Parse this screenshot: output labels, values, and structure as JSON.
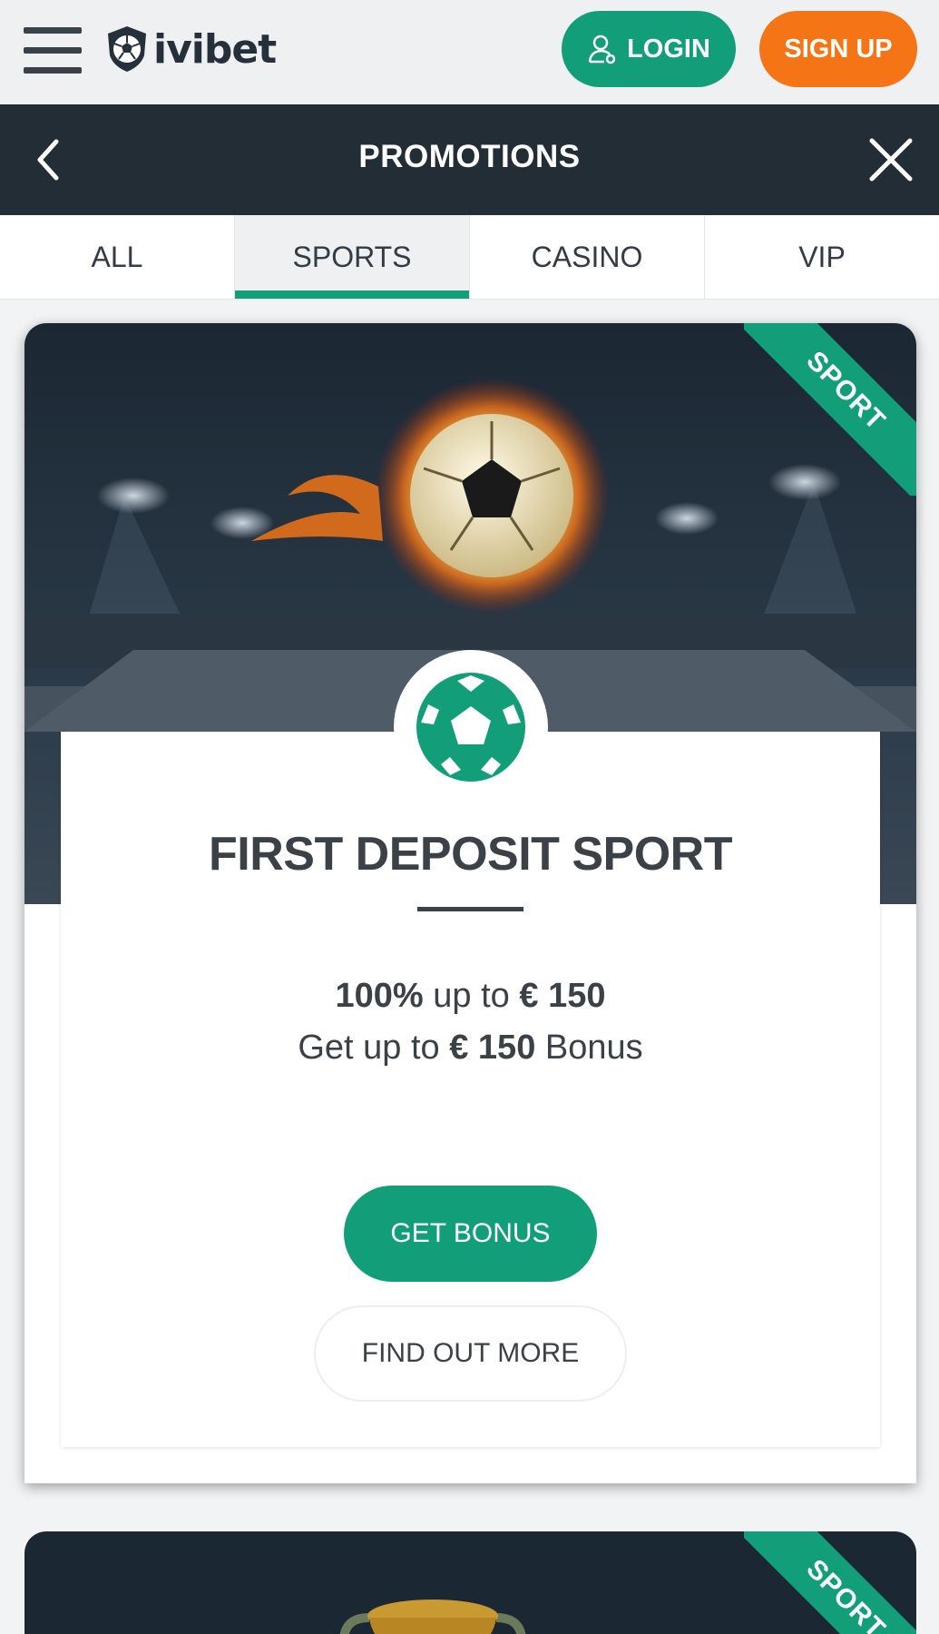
{
  "header": {
    "logo_text": "ivibet",
    "login_label": "LOGIN",
    "signup_label": "SIGN UP"
  },
  "titlebar": {
    "title": "PROMOTIONS"
  },
  "tabs": [
    {
      "label": "ALL",
      "active": false
    },
    {
      "label": "SPORTS",
      "active": true
    },
    {
      "label": "CASINO",
      "active": false
    },
    {
      "label": "VIP",
      "active": false
    }
  ],
  "promos": [
    {
      "ribbon": "SPORT",
      "title": "FIRST DEPOSIT SPORT",
      "line1_bold_a": "100%",
      "line1_mid": " up to ",
      "line1_bold_b": "€ 150",
      "line2_pre": "Get up to ",
      "line2_bold": "€ 150",
      "line2_post": " Bonus",
      "primary_button": "GET BONUS",
      "secondary_button": "FIND OUT MORE"
    },
    {
      "ribbon": "SPORT"
    }
  ],
  "colors": {
    "brand_green": "#129e78",
    "signup_orange": "#f47416",
    "dark_bar": "#222d35"
  }
}
